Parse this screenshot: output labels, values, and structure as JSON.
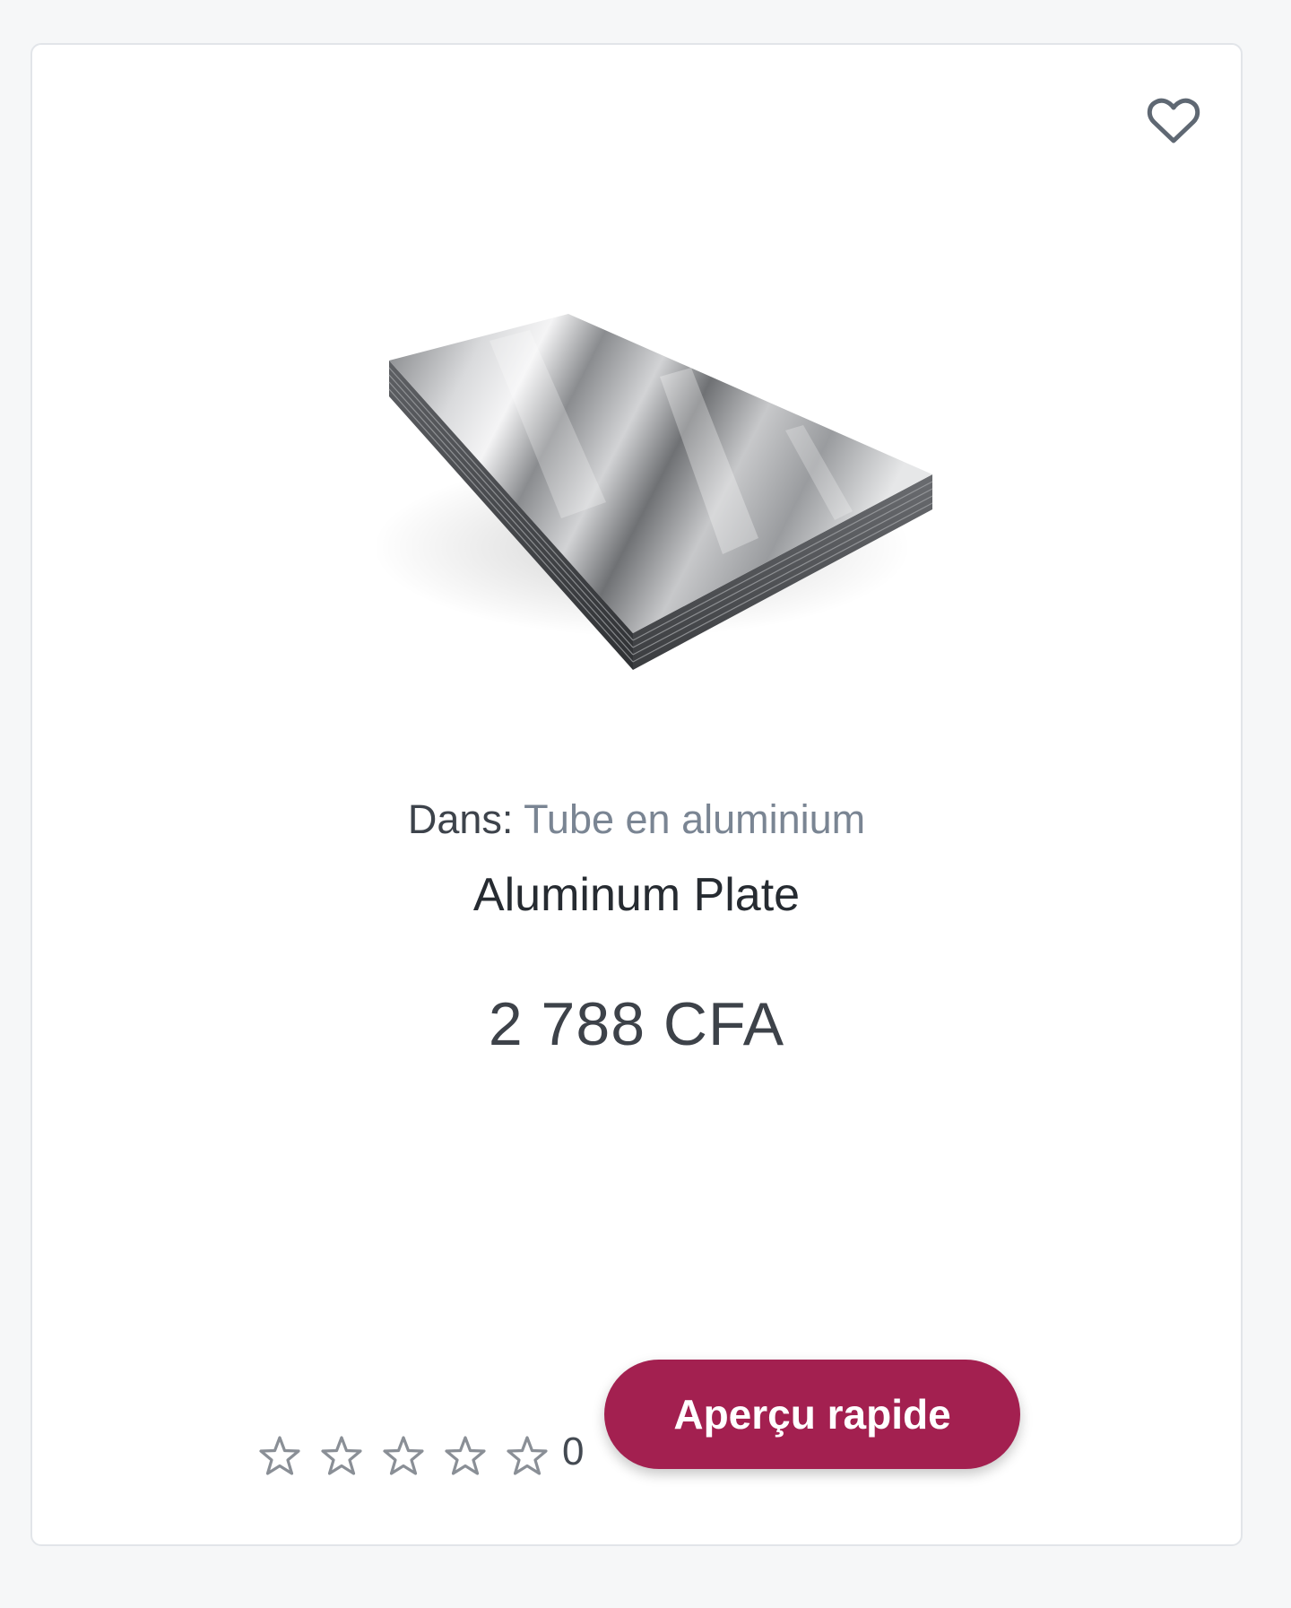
{
  "card": {
    "category_prefix": "Dans:",
    "category_name": "Tube en aluminium",
    "title": "Aluminum Plate",
    "price": "2 788 CFA",
    "rating": {
      "stars_filled": 0,
      "stars_total": 5,
      "count": "0"
    },
    "quick_view_label": "Aperçu rapide",
    "wishlist_icon": "heart-icon",
    "image_alt": "Aluminum Plate"
  },
  "colors": {
    "accent": "#a32050",
    "category_link": "#7a8593",
    "star_outline": "#8a8f96"
  }
}
